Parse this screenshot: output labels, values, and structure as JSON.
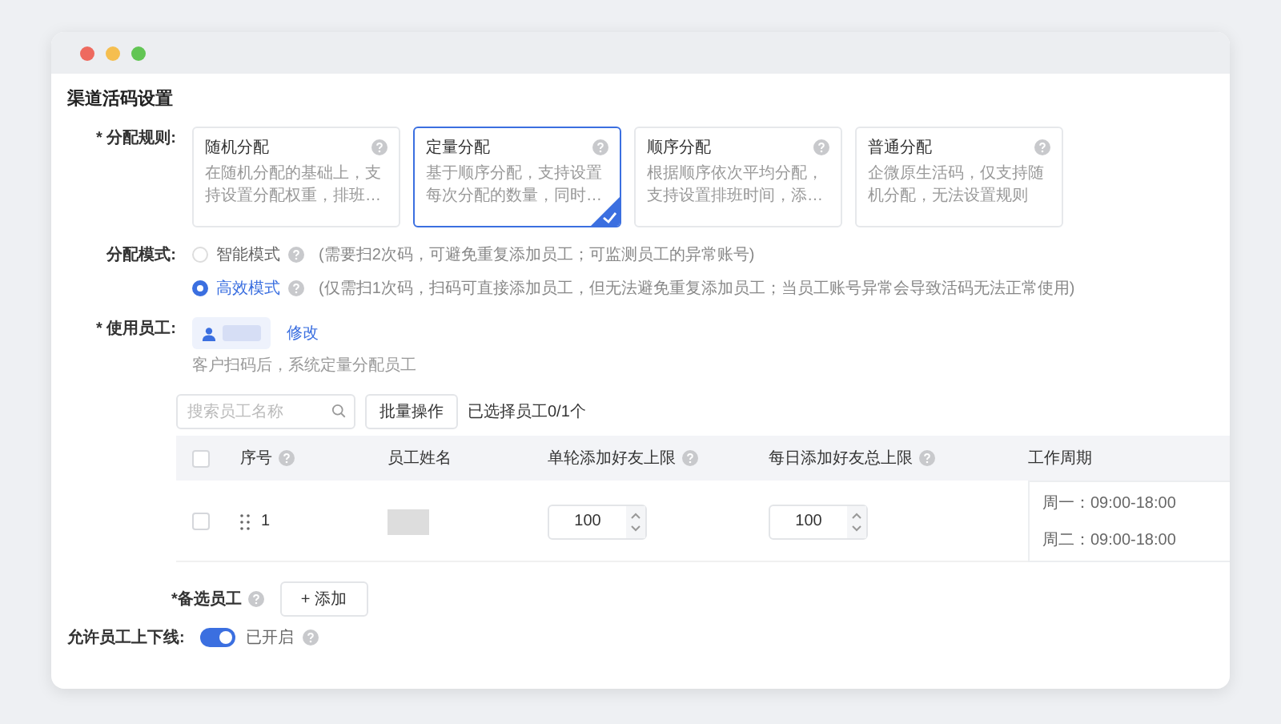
{
  "title": "渠道活码设置",
  "rule": {
    "label": "* 分配规则:",
    "options": [
      {
        "name": "随机分配",
        "desc": "在随机分配的基础上，支持设置分配权重，排班…",
        "selected": false
      },
      {
        "name": "定量分配",
        "desc": "基于顺序分配，支持设置每次分配的数量，同时…",
        "selected": true
      },
      {
        "name": "顺序分配",
        "desc": "根据顺序依次平均分配，支持设置排班时间，添…",
        "selected": false
      },
      {
        "name": "普通分配",
        "desc": "企微原生活码，仅支持随机分配，无法设置规则",
        "selected": false
      }
    ]
  },
  "mode": {
    "label": "分配模式:",
    "options": [
      {
        "name": "智能模式",
        "desc": "(需要扫2次码，可避免重复添加员工；可监测员工的异常账号)",
        "selected": false
      },
      {
        "name": "高效模式",
        "desc": "(仅需扫1次码，扫码可直接添加员工，但无法避免重复添加员工；当员工账号异常会导致活码无法正常使用)",
        "selected": true
      }
    ]
  },
  "staff": {
    "label": "* 使用员工:",
    "edit_link": "修改",
    "hint": "客户扫码后，系统定量分配员工"
  },
  "search": {
    "placeholder": "搜索员工名称"
  },
  "batch_button": "批量操作",
  "selected_count": "已选择员工0/1个",
  "table": {
    "header_checked": false,
    "columns": [
      {
        "label": "序号",
        "help": true
      },
      {
        "label": "员工姓名",
        "help": false
      },
      {
        "label": "单轮添加好友上限",
        "help": true
      },
      {
        "label": "每日添加好友总上限",
        "help": true
      },
      {
        "label": "工作周期",
        "help": false
      }
    ],
    "rows": [
      {
        "checked": false,
        "index": "1",
        "single_limit": "100",
        "daily_limit": "100",
        "schedule": [
          "周一：09:00-18:00",
          "周二：09:00-18:00"
        ]
      }
    ]
  },
  "backup": {
    "label": "*备选员工",
    "add_button": "+ 添加"
  },
  "online": {
    "label": "允许员工上下线:",
    "on": true,
    "status": "已开启"
  }
}
